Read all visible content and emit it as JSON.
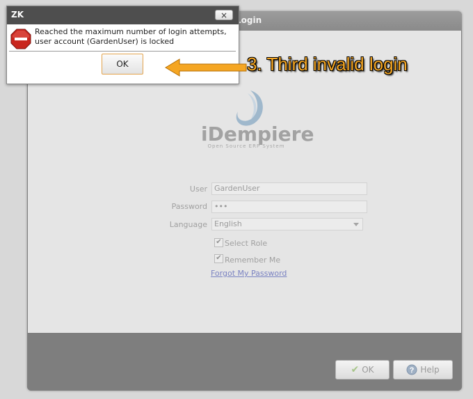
{
  "login_window": {
    "title": "Login",
    "logo": {
      "name": "iDempiere",
      "tagline": "Open Source ERP System"
    },
    "form": {
      "user_label": "User",
      "user_value": "GardenUser",
      "password_label": "Password",
      "password_value": "•••",
      "language_label": "Language",
      "language_value": "English",
      "select_role_label": "Select Role",
      "select_role_checked": true,
      "remember_me_label": "Remember Me",
      "remember_me_checked": true,
      "forgot_password_link": "Forgot My Password"
    },
    "footer": {
      "ok_label": "OK",
      "help_label": "Help"
    }
  },
  "dialog": {
    "title": "ZK",
    "close_glyph": "×",
    "message": "Reached the maximum number of login attempts, user account (GardenUser) is locked",
    "ok_label": "OK",
    "icon": "stop-icon"
  },
  "annotation": {
    "text": "3. Third invalid login",
    "color": "#f5a623"
  },
  "colors": {
    "dialog_titlebar": "#4e4e4e",
    "ok_focus_border": "#e3a34b",
    "link": "#7a82c2"
  }
}
